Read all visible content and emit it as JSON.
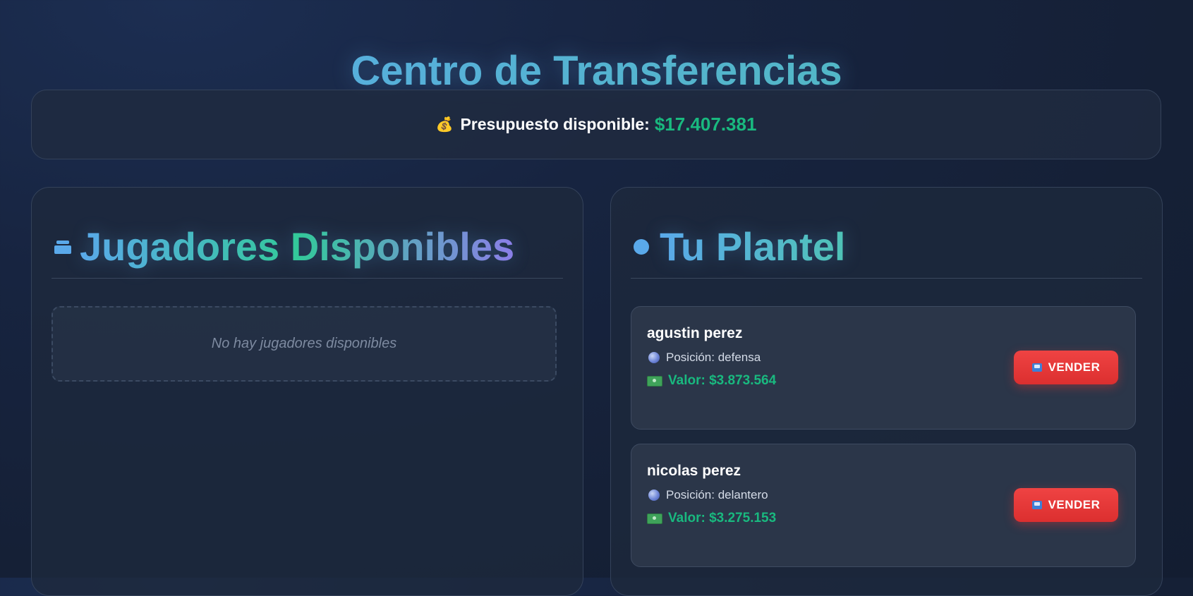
{
  "page": {
    "title": "Centro de Transferencias"
  },
  "budget": {
    "icon": "money-bag-icon",
    "label": "Presupuesto disponible:",
    "amount": "$17.407.381"
  },
  "available_players": {
    "icon": "box-icon",
    "title": "Jugadores Disponibles",
    "empty_message": "No hay jugadores disponibles",
    "players": []
  },
  "squad": {
    "icon": "dot-icon",
    "title": "Tu Plantel",
    "players": [
      {
        "name": "agustin perez",
        "position": "Posición: defensa",
        "value": "Valor: $3.873.564",
        "sell_label": "VENDER"
      },
      {
        "name": "nicolas perez",
        "position": "Posición: delantero",
        "value": "Valor: $3.275.153",
        "sell_label": "VENDER"
      }
    ]
  },
  "colors": {
    "accent_blue": "#5aa9ea",
    "accent_green": "#19b97f",
    "sell_red": "#e53838",
    "background": "#152036"
  }
}
